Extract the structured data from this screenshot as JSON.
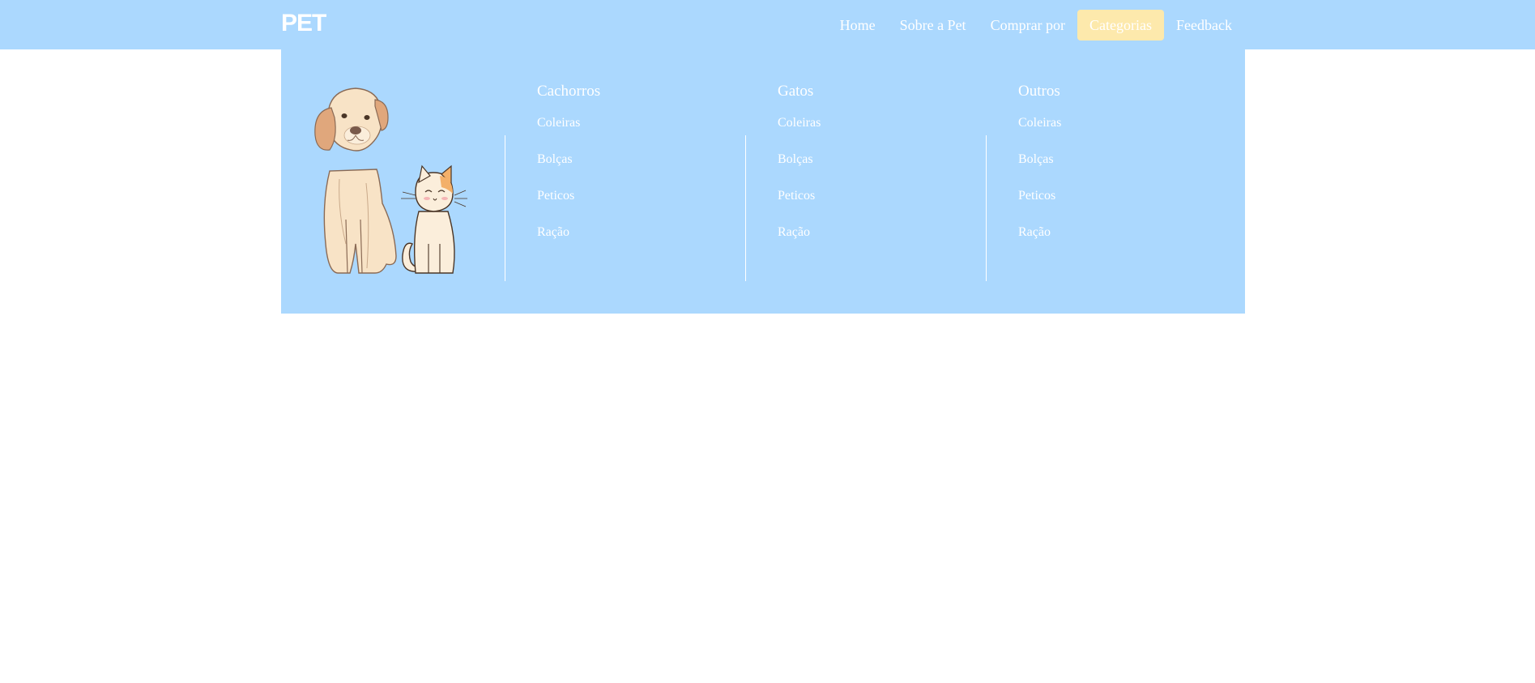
{
  "brand": {
    "logo_text": "PET"
  },
  "nav": {
    "items": [
      {
        "label": "Home"
      },
      {
        "label": "Sobre a Pet"
      },
      {
        "label": "Comprar por"
      },
      {
        "label": "Categorias",
        "active": true
      },
      {
        "label": "Feedback"
      }
    ]
  },
  "dropdown": {
    "columns": [
      {
        "title": "Cachorros",
        "items": [
          "Coleiras",
          "Bolças",
          "Peticos",
          "Ração"
        ]
      },
      {
        "title": "Gatos",
        "items": [
          "Coleiras",
          "Bolças",
          "Peticos",
          "Ração"
        ]
      },
      {
        "title": "Outros",
        "items": [
          "Coleiras",
          "Bolças",
          "Peticos",
          "Ração"
        ]
      }
    ]
  },
  "colors": {
    "navbar_bg": "#abd8fe",
    "active_bg": "#fde9ac",
    "text": "#ffffff"
  },
  "illustration": {
    "icons": [
      "dog-icon",
      "cat-icon"
    ]
  }
}
